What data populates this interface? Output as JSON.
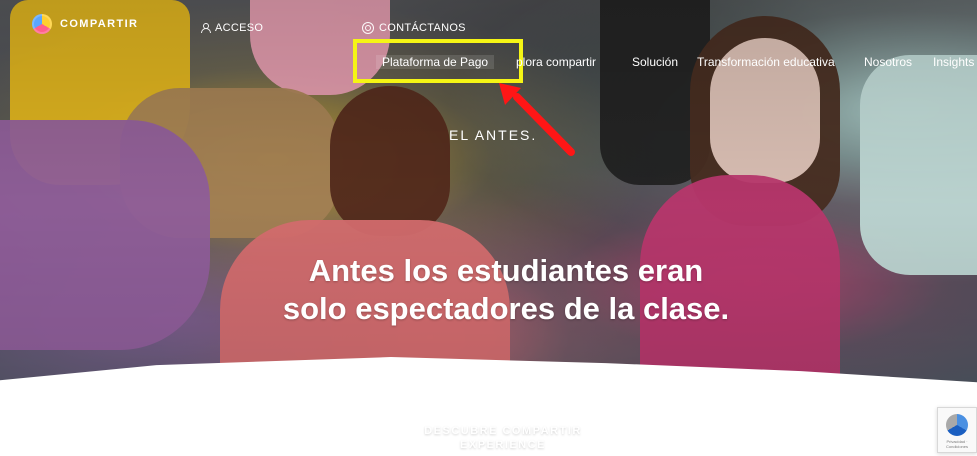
{
  "header": {
    "brand": "COMPARTIR",
    "access": "ACCESO",
    "contact": "CONTÁCTANOS"
  },
  "nav": {
    "payment": "Plataforma de Pago",
    "explore": "plora compartir",
    "solution": "Solución",
    "transformation": "Transformación educativa",
    "about": "Nosotros",
    "insights": "Insights"
  },
  "hero": {
    "eyebrow": "EL ANTES.",
    "title_line_1": "Antes los estudiantes eran",
    "title_line_2": "solo espectadores de la clase."
  },
  "cta": {
    "line_1": "DESCUBRE COMPARTIR",
    "line_2": "EXPERIENCE"
  },
  "recaptcha": {
    "text": "Privacidad · Condiciones"
  },
  "colors": {
    "highlight": "#f5f515",
    "arrow": "#ff1616",
    "text": "#ffffff"
  },
  "icons": {
    "brand": "brand-logo-icon",
    "access": "user-icon",
    "contact": "contact-icon",
    "arrow": "red-arrow-icon",
    "recaptcha": "recaptcha-icon"
  }
}
